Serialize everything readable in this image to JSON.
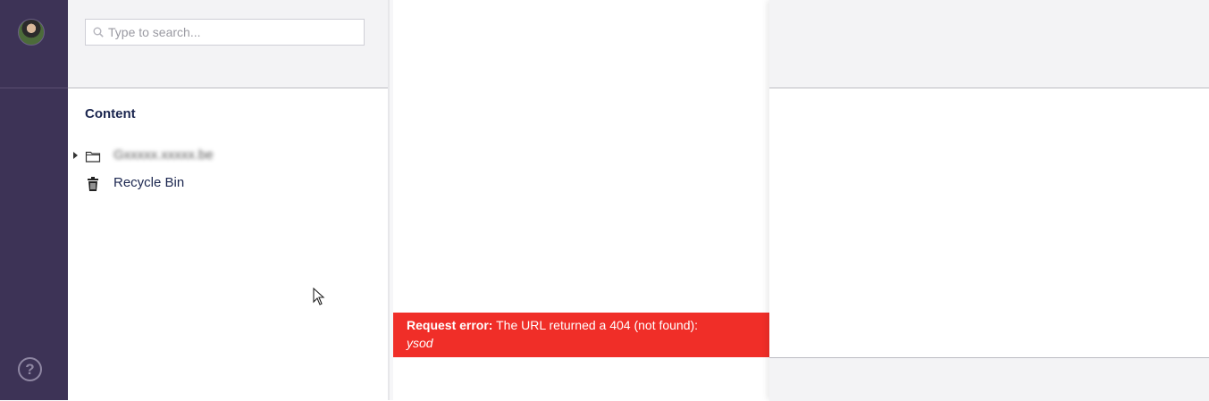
{
  "sidebar_rail": {
    "avatar_alt": "User avatar",
    "help_icon": "question-circle-icon"
  },
  "search": {
    "placeholder": "Type to search...",
    "icon": "search-icon"
  },
  "tree": {
    "section_title": "Content",
    "items": [
      {
        "label": "Gxxxxx.xxxxx.be",
        "icon": "folder-icon",
        "expandable": true,
        "blurred": true
      },
      {
        "label": "Recycle Bin",
        "icon": "trash-icon",
        "expandable": false
      }
    ]
  },
  "error": {
    "label": "Request error:",
    "message": " The URL returned a 404 (not found):",
    "detail": "ysod"
  },
  "colors": {
    "rail": "#3d3356",
    "error": "#f02e28",
    "panel_header": "#f3f3f5",
    "text": "#1b264f"
  }
}
